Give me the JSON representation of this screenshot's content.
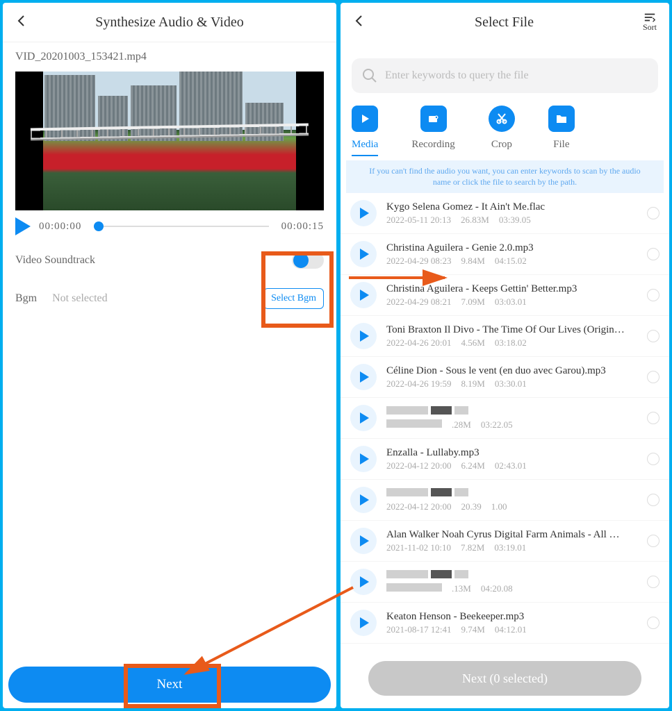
{
  "left": {
    "title": "Synthesize Audio & Video",
    "filename": "VID_20201003_153421.mp4",
    "current_time": "00:00:00",
    "duration": "00:00:15",
    "soundtrack_label": "Video Soundtrack",
    "bgm_label": "Bgm",
    "bgm_value": "Not selected",
    "select_bgm": "Select Bgm",
    "next": "Next"
  },
  "right": {
    "title": "Select File",
    "sort": "Sort",
    "search_placeholder": "Enter keywords to query the file",
    "tabs": [
      {
        "label": "Media"
      },
      {
        "label": "Recording"
      },
      {
        "label": "Crop"
      },
      {
        "label": "File"
      }
    ],
    "hint": "If you can't find the audio you want, you can enter keywords to scan by the audio name or click the file to search by the path.",
    "files": [
      {
        "title": "Kygo Selena Gomez - It Ain't Me.flac",
        "date": "2022-05-11 20:13",
        "size": "26.83M",
        "dur": "03:39.05"
      },
      {
        "title": "Christina Aguilera - Genie 2.0.mp3",
        "date": "2022-04-29 08:23",
        "size": "9.84M",
        "dur": "04:15.02"
      },
      {
        "title": "Christina Aguilera - Keeps Gettin' Better.mp3",
        "date": "2022-04-29 08:21",
        "size": "7.09M",
        "dur": "03:03.01"
      },
      {
        "title": "Toni Braxton Il Divo - The Time Of Our Lives (Origin…",
        "date": "2022-04-26 20:01",
        "size": "4.56M",
        "dur": "03:18.02"
      },
      {
        "title": "Céline Dion - Sous le vent (en duo avec Garou).mp3",
        "date": "2022-04-26 19:59",
        "size": "8.19M",
        "dur": "03:30.01"
      },
      {
        "title": "",
        "date": "",
        "size": ".28M",
        "dur": "03:22.05",
        "redacted": true
      },
      {
        "title": "Enzalla - Lullaby.mp3",
        "date": "2022-04-12 20:00",
        "size": "6.24M",
        "dur": "02:43.01"
      },
      {
        "title": "",
        "date": "2022-04-12 20:00",
        "size": "20.39",
        "dur": "1.00",
        "redacted": true
      },
      {
        "title": "Alan Walker Noah Cyrus Digital Farm Animals - All …",
        "date": "2021-11-02 10:10",
        "size": "7.82M",
        "dur": "03:19.01"
      },
      {
        "title": "",
        "date": "",
        "size": ".13M",
        "dur": "04:20.08",
        "redacted": true
      },
      {
        "title": "Keaton Henson - Beekeeper.mp3",
        "date": "2021-08-17 12:41",
        "size": "9.74M",
        "dur": "04:12.01"
      }
    ],
    "next": "Next (0 selected)"
  }
}
